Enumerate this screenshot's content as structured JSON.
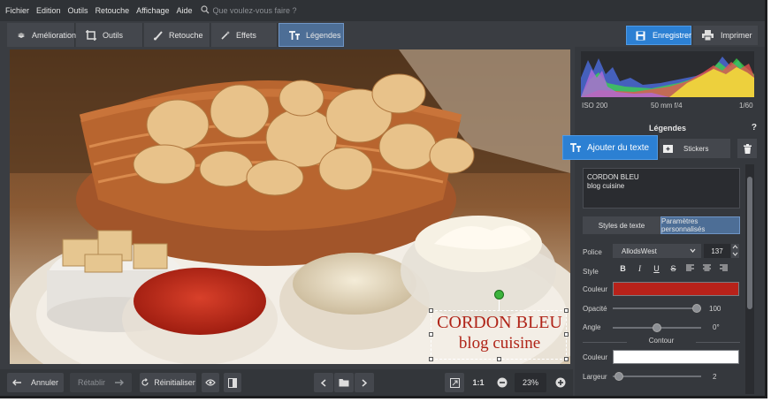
{
  "menu": {
    "items": [
      "Fichier",
      "Edition",
      "Outils",
      "Retouche",
      "Affichage",
      "Aide"
    ],
    "search_placeholder": "Que voulez-vous faire ?"
  },
  "toolbar": {
    "tabs": [
      {
        "label": "Amélioration",
        "icon": "layers-icon"
      },
      {
        "label": "Outils",
        "icon": "crop-icon"
      },
      {
        "label": "Retouche",
        "icon": "brush-icon"
      },
      {
        "label": "Effets",
        "icon": "wand-icon"
      },
      {
        "label": "Légendes",
        "icon": "text-icon",
        "active": true
      }
    ],
    "save_label": "Enregistrer",
    "print_label": "Imprimer"
  },
  "canvas": {
    "caption_line1": "CORDON BLEU",
    "caption_line2": "blog cuisine"
  },
  "bottom_bar": {
    "undo_label": "Annuler",
    "redo_label": "Rétablir",
    "reset_label": "Réinitialiser",
    "zoom_1to1": "1:1",
    "zoom_value": "23%"
  },
  "panel": {
    "exif": {
      "iso": "ISO 200",
      "lens": "50 mm f/4",
      "shutter": "1/60"
    },
    "title": "Légendes",
    "help": "?",
    "add_text_label": "Ajouter du texte",
    "stickers_label": "Stickers",
    "text_content_line1": "CORDON BLEU",
    "text_content_line2": "blog cuisine",
    "tab_text_styles": "Styles de texte",
    "tab_custom": "Paramètres personnalisés",
    "font_label": "Police",
    "font_value": "AllodsWest",
    "font_size": "137",
    "style_label": "Style",
    "color_label": "Couleur",
    "color_value": "#b8221a",
    "opacity_label": "Opacité",
    "opacity_value": "100",
    "opacity_fraction": 1.0,
    "angle_label": "Angle",
    "angle_value": "0°",
    "angle_fraction": 0.5,
    "outline_header": "Contour",
    "outline_color_label": "Couleur",
    "outline_color_value": "#ffffff",
    "width_label": "Largeur",
    "width_value": "2",
    "width_fraction": 0.02
  },
  "colors": {
    "accent": "#2c80d3",
    "active_tab": "#4d6e96",
    "background": "#3a3d42"
  }
}
